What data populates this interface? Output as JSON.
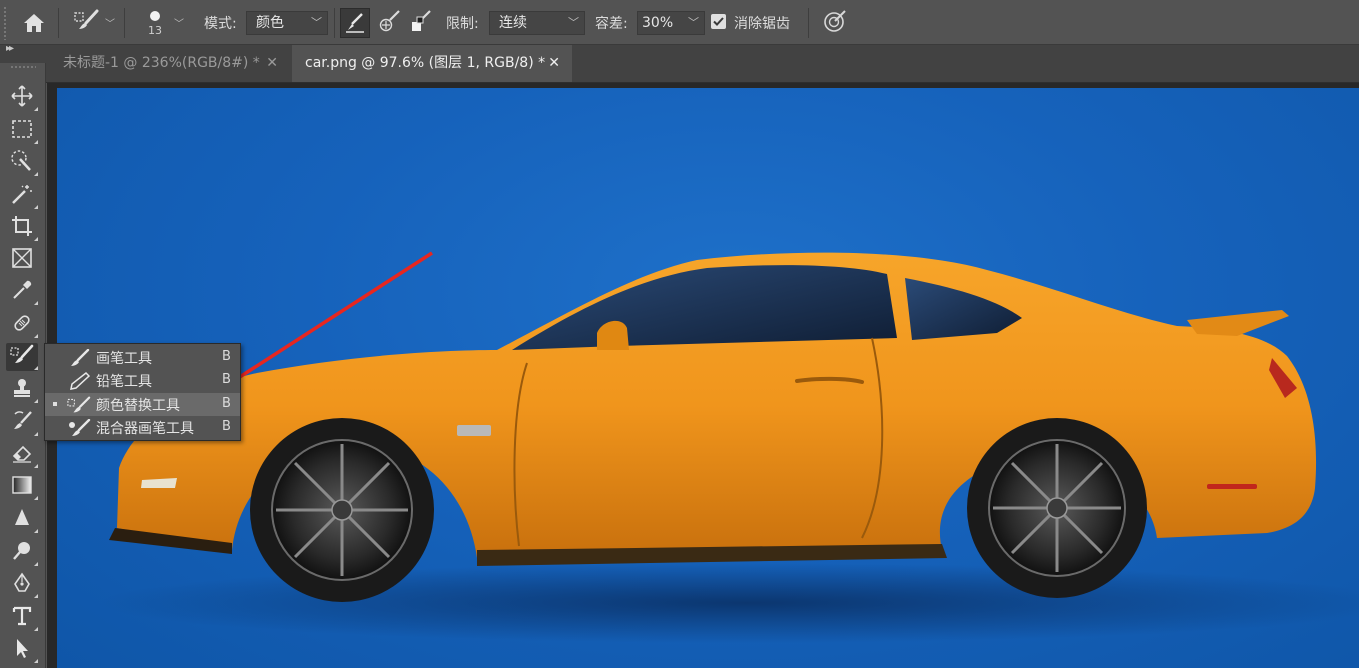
{
  "options_bar": {
    "home_icon": "home-icon",
    "tool_preset_icon": "color-replacement-brush-icon",
    "brush_size": "13",
    "mode_label": "模式:",
    "mode_value": "颜色",
    "sampling_icons": [
      "sampling-continuous-icon",
      "sampling-once-icon",
      "sampling-background-swatch-icon"
    ],
    "limits_label": "限制:",
    "limits_value": "连续",
    "tolerance_label": "容差:",
    "tolerance_value": "30%",
    "antialias_label": "消除锯齿",
    "antialias_checked": true,
    "pressure_icon": "pen-pressure-icon"
  },
  "tabs": [
    {
      "label": "未标题-1 @ 236%(RGB/8#) *",
      "active": false
    },
    {
      "label": "car.png @ 97.6% (图层 1, RGB/8) *",
      "active": true
    }
  ],
  "tab_close_glyph": "✕",
  "toolbar": {
    "collapse_glyph": "▸▸",
    "tools": [
      "move-icon",
      "marquee-icon",
      "quick-selection-icon",
      "magic-wand-icon",
      "crop-icon",
      "frame-icon",
      "eyedropper-icon",
      "healing-brush-icon",
      "brush-group-icon",
      "clone-stamp-icon",
      "history-brush-icon",
      "eraser-icon",
      "gradient-icon",
      "blur-icon",
      "dodge-icon",
      "pen-icon",
      "type-icon",
      "path-selection-icon"
    ]
  },
  "tool_flyout": {
    "items": [
      {
        "label": "画笔工具",
        "shortcut": "B",
        "icon": "brush-icon",
        "selected": false
      },
      {
        "label": "铅笔工具",
        "shortcut": "B",
        "icon": "pencil-icon",
        "selected": false
      },
      {
        "label": "颜色替换工具",
        "shortcut": "B",
        "icon": "color-replacement-icon",
        "selected": true
      },
      {
        "label": "混合器画笔工具",
        "shortcut": "B",
        "icon": "mixer-brush-icon",
        "selected": false
      }
    ]
  },
  "colors": {
    "background_blue": "#1662bb",
    "car_orange": "#f0951c",
    "arrow_red": "#e8261f",
    "ui_panel": "#535353"
  }
}
